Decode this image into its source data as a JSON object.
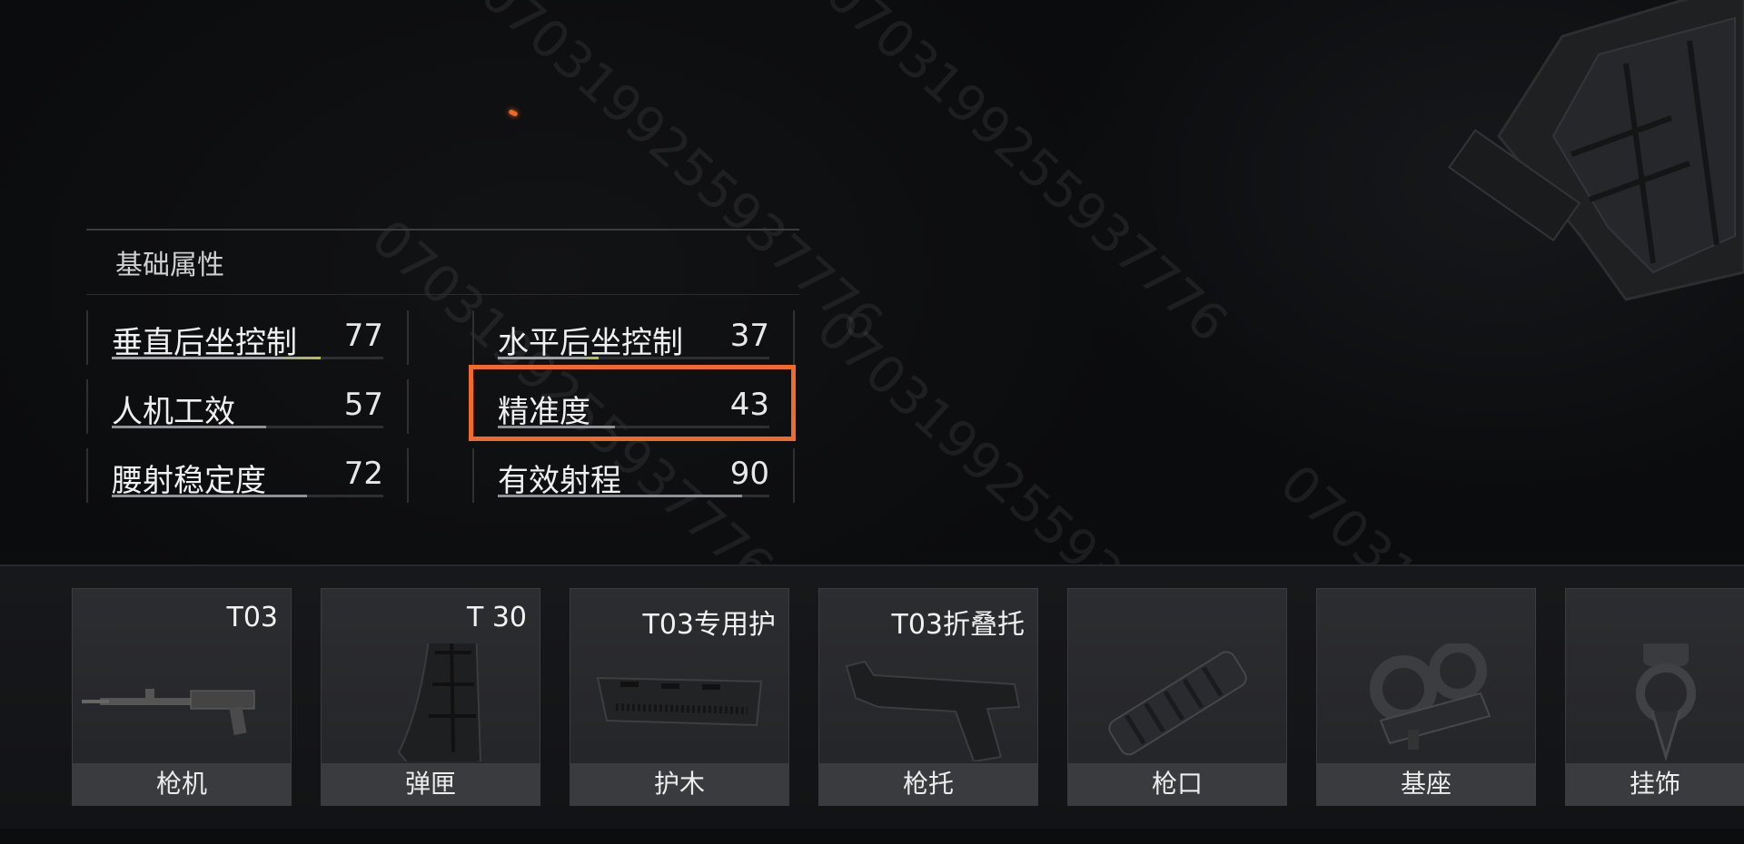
{
  "stats_panel": {
    "title": "基础属性",
    "stats": [
      {
        "name": "垂直后坐控制",
        "value": "77",
        "level": 0.77
      },
      {
        "name": "水平后坐控制",
        "value": "37",
        "level": 0.37
      },
      {
        "name": "人机工效",
        "value": "57",
        "level": 0.57
      },
      {
        "name": "精准度",
        "value": "43",
        "level": 0.43
      },
      {
        "name": "腰射稳定度",
        "value": "72",
        "level": 0.72
      },
      {
        "name": "有效射程",
        "value": "90",
        "level": 0.9
      }
    ],
    "highlighted_stat": "精准度",
    "highlight_color": "#ef6a2b"
  },
  "watermark": "0703199255937776",
  "parts": [
    {
      "label": "枪机",
      "name": "T03",
      "icon": "receiver-icon"
    },
    {
      "label": "弹匣",
      "name": "T 30",
      "icon": "magazine-icon"
    },
    {
      "label": "护木",
      "name": "T03专用护",
      "icon": "handguard-icon"
    },
    {
      "label": "枪托",
      "name": "T03折叠托",
      "icon": "stock-icon"
    },
    {
      "label": "枪口",
      "name": "",
      "icon": "muzzle-icon"
    },
    {
      "label": "基座",
      "name": "",
      "icon": "mount-icon"
    },
    {
      "label": "挂饰",
      "name": "",
      "icon": "charm-icon"
    }
  ]
}
